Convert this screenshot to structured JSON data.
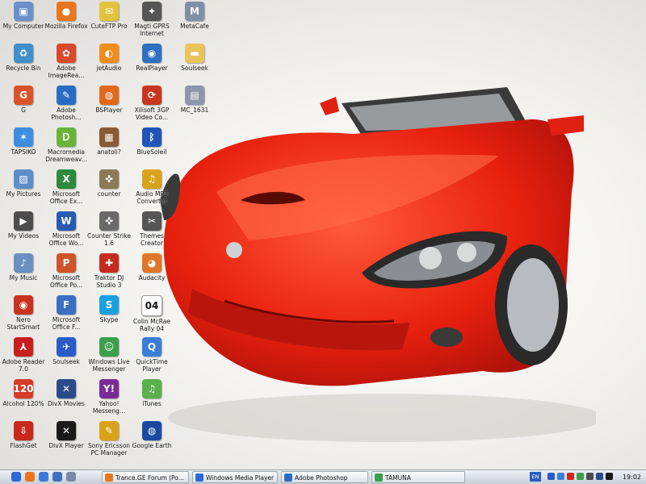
{
  "icons": [
    {
      "label": "My Computer",
      "icon": "computer-icon",
      "color": "#6b8fc9",
      "glyph": "▣"
    },
    {
      "label": "Mozilla Firefox",
      "icon": "firefox-icon",
      "color": "#e9761c",
      "glyph": "●"
    },
    {
      "label": "CuteFTP Pro",
      "icon": "ftp-icon",
      "color": "#e2c23c",
      "glyph": "✉"
    },
    {
      "label": "Magti GPRS Internet",
      "icon": "network-icon",
      "color": "#555555",
      "glyph": "✦"
    },
    {
      "label": "MetaCafe",
      "icon": "metacafe-icon",
      "color": "#7f8fa6",
      "glyph": "M"
    },
    {
      "label": "Recycle Bin",
      "icon": "recycle-bin-icon",
      "color": "#3f8fc8",
      "glyph": "♻"
    },
    {
      "label": "Adobe ImageRea...",
      "icon": "imageready-icon",
      "color": "#d84a2a",
      "glyph": "✿"
    },
    {
      "label": "jetAudio",
      "icon": "jetaudio-icon",
      "color": "#f08c1a",
      "glyph": "◐"
    },
    {
      "label": "RealPlayer",
      "icon": "realplayer-icon",
      "color": "#2f6fc0",
      "glyph": "◉"
    },
    {
      "label": "Soulseek",
      "icon": "folder-icon",
      "color": "#e8c45a",
      "glyph": "▬"
    },
    {
      "label": "G",
      "icon": "g-icon",
      "color": "#d9542a",
      "glyph": "G"
    },
    {
      "label": "Adobe Photosh...",
      "icon": "photoshop-icon",
      "color": "#2a6cc4",
      "glyph": "✎"
    },
    {
      "label": "BSPlayer",
      "icon": "bsplayer-icon",
      "color": "#e2681a",
      "glyph": "◍"
    },
    {
      "label": "Xilisoft 3GP Video Co...",
      "icon": "xilisoft-icon",
      "color": "#c8361e",
      "glyph": "⟳"
    },
    {
      "label": "MC_1631",
      "icon": "image-file-icon",
      "color": "#8d96ad",
      "glyph": "▤"
    },
    {
      "label": "TAPSIKO",
      "icon": "msn-butterfly-icon",
      "color": "#3e8ee0",
      "glyph": "✶"
    },
    {
      "label": "Macromedia Dreamweav...",
      "icon": "dreamweaver-icon",
      "color": "#6ab33a",
      "glyph": "Ꭰ"
    },
    {
      "label": "anatoli?",
      "icon": "picture-icon",
      "color": "#8a5a33",
      "glyph": "▦"
    },
    {
      "label": "BlueSoleil",
      "icon": "bluetooth-icon",
      "color": "#2055b8",
      "glyph": "ᛒ"
    },
    {
      "label": "My Pictures",
      "icon": "my-pictures-icon",
      "color": "#5e8cc9",
      "glyph": "▨"
    },
    {
      "label": "Microsoft Office Ex...",
      "icon": "excel-icon",
      "color": "#2f8a3e",
      "glyph": "X"
    },
    {
      "label": "counter",
      "icon": "counter-strike-icon",
      "color": "#8a7a55",
      "glyph": "✜"
    },
    {
      "label": "Audio MP3 Converter",
      "icon": "mp3-converter-icon",
      "color": "#d8a21a",
      "glyph": "♫"
    },
    {
      "label": "My Videos",
      "icon": "my-videos-icon",
      "color": "#4d4d4d",
      "glyph": "▶"
    },
    {
      "label": "Microsoft Office Wo...",
      "icon": "word-icon",
      "color": "#2a5bb3",
      "glyph": "W"
    },
    {
      "label": "Counter Strike 1.6",
      "icon": "counter-strike-16-icon",
      "color": "#6a6a6a",
      "glyph": "✜"
    },
    {
      "label": "Themes Creator",
      "icon": "themes-icon",
      "color": "#555555",
      "glyph": "✂"
    },
    {
      "label": "My Music",
      "icon": "my-music-icon",
      "color": "#6a8fc0",
      "glyph": "♪"
    },
    {
      "label": "Microsoft Office Po...",
      "icon": "powerpoint-icon",
      "color": "#d0542a",
      "glyph": "P"
    },
    {
      "label": "Traktor DJ Studio 3",
      "icon": "traktor-icon",
      "color": "#c62a1e",
      "glyph": "✚"
    },
    {
      "label": "Audacity",
      "icon": "audacity-icon",
      "color": "#e0762a",
      "glyph": "◕"
    },
    {
      "label": "Nero StartSmart",
      "icon": "nero-icon",
      "color": "#c8321e",
      "glyph": "◉"
    },
    {
      "label": "Microsoft Office F...",
      "icon": "frontpage-icon",
      "color": "#3b6fc4",
      "glyph": "F"
    },
    {
      "label": "Skype",
      "icon": "skype-icon",
      "color": "#1aa0e0",
      "glyph": "S"
    },
    {
      "label": "Colin McRae Rally 04",
      "icon": "colin-mcrae-icon",
      "color": "#ffffff",
      "glyph": "04"
    },
    {
      "label": "Adobe Reader 7.0",
      "icon": "adobe-reader-icon",
      "color": "#c81e1e",
      "glyph": "⅄"
    },
    {
      "label": "Soulseek",
      "icon": "soulseek-bird-icon",
      "color": "#2a5bc8",
      "glyph": "✈"
    },
    {
      "label": "Windows Live Messenger",
      "icon": "messenger-icon",
      "color": "#3aa04a",
      "glyph": "☺"
    },
    {
      "label": "QuickTime Player",
      "icon": "quicktime-icon",
      "color": "#3a7ed8",
      "glyph": "Q"
    },
    {
      "label": "Alcohol 120%",
      "icon": "alcohol-icon",
      "color": "#d83a2a",
      "glyph": "120"
    },
    {
      "label": "DivX Movies",
      "icon": "divx-movies-icon",
      "color": "#2a4a8a",
      "glyph": "✕"
    },
    {
      "label": "Yahoo! Messeng...",
      "icon": "yahoo-icon",
      "color": "#7a2a9a",
      "glyph": "Y!"
    },
    {
      "label": "iTunes",
      "icon": "itunes-icon",
      "color": "#5ab04a",
      "glyph": "♫"
    },
    {
      "label": "FlashGet",
      "icon": "flashget-icon",
      "color": "#c8281e",
      "glyph": "⇩"
    },
    {
      "label": "DivX Player",
      "icon": "divx-player-icon",
      "color": "#1a1a1a",
      "glyph": "✕"
    },
    {
      "label": "Sony Ericsson PC Manager",
      "icon": "sony-ericsson-icon",
      "color": "#d8a21a",
      "glyph": "✎"
    },
    {
      "label": "Google Earth",
      "icon": "google-earth-icon",
      "color": "#1a4aa0",
      "glyph": "◍"
    }
  ],
  "taskbar": {
    "quick_launch": [
      {
        "icon": "start-orb-icon",
        "color": "#2a6ad8"
      },
      {
        "icon": "firefox-ql-icon",
        "color": "#e9761c"
      },
      {
        "icon": "ie-ql-icon",
        "color": "#3b7ad8"
      },
      {
        "icon": "outlook-ql-icon",
        "color": "#3f6fc0"
      },
      {
        "icon": "desktop-ql-icon",
        "color": "#7a8aa8"
      }
    ],
    "tasks": [
      {
        "label": "Trance.GE Forum (Po...",
        "icon": "firefox-task-icon",
        "color": "#e9761c"
      },
      {
        "label": "Windows Media Player",
        "icon": "wmp-task-icon",
        "color": "#2a6ad8"
      },
      {
        "label": "Adobe Photoshop",
        "icon": "photoshop-task-icon",
        "color": "#2a6cc4"
      },
      {
        "label": "TAMUNA",
        "icon": "msn-task-icon",
        "color": "#3aa04a"
      }
    ],
    "tray": {
      "language": "EN",
      "icons": [
        {
          "icon": "soulseek-tray-icon",
          "color": "#2a5bc8"
        },
        {
          "icon": "phone-tray-icon",
          "color": "#3a7ed8"
        },
        {
          "icon": "antivirus-tray-icon",
          "color": "#c8281e"
        },
        {
          "icon": "messenger-tray-icon",
          "color": "#3aa04a"
        },
        {
          "icon": "volume-tray-icon",
          "color": "#4a4a4a"
        },
        {
          "icon": "network-tray-icon",
          "color": "#2a4a8a"
        },
        {
          "icon": "display-tray-icon",
          "color": "#1a1a1a"
        }
      ],
      "clock": "19:02"
    }
  }
}
